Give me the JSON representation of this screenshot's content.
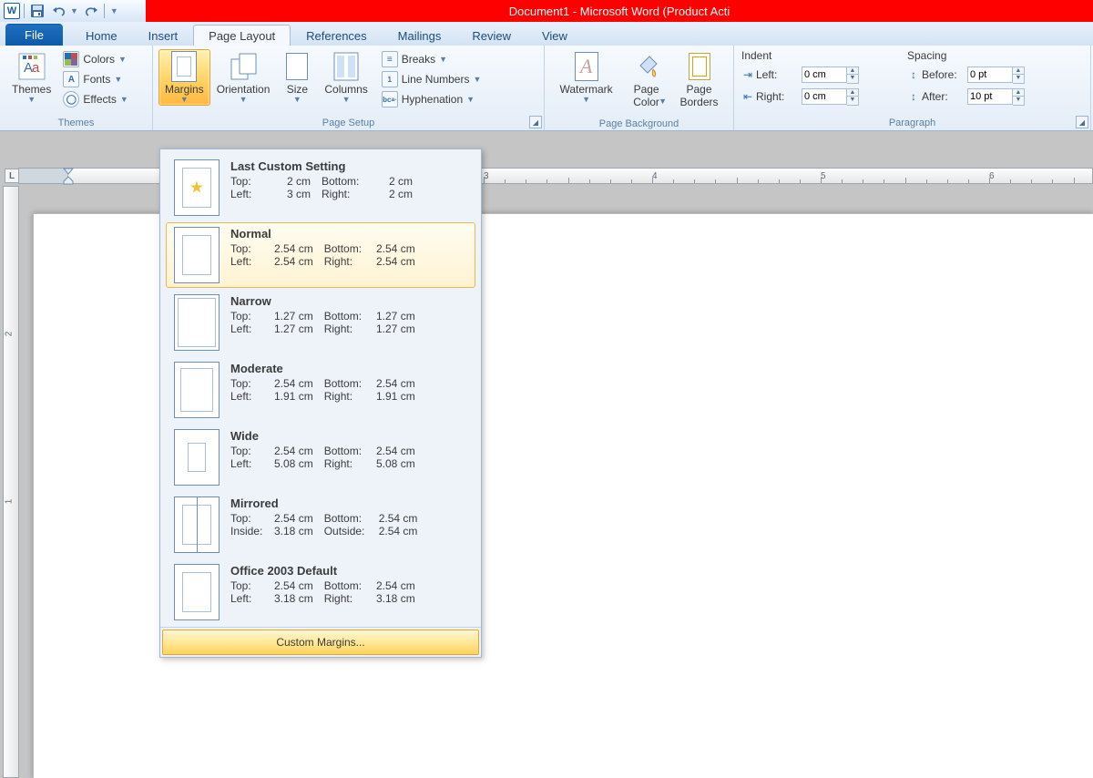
{
  "title": "Document1 - Microsoft Word (Product Acti",
  "tabs": {
    "file": "File",
    "home": "Home",
    "insert": "Insert",
    "pagelayout": "Page Layout",
    "references": "References",
    "mailings": "Mailings",
    "review": "Review",
    "view": "View"
  },
  "themes": {
    "group": "Themes",
    "themes": "Themes",
    "colors": "Colors",
    "fonts": "Fonts",
    "effects": "Effects"
  },
  "pagesetup": {
    "group": "Page Setup",
    "margins": "Margins",
    "orientation": "Orientation",
    "size": "Size",
    "columns": "Columns",
    "breaks": "Breaks",
    "lineNumbers": "Line Numbers",
    "hyphenation": "Hyphenation"
  },
  "pagebg": {
    "group": "Page Background",
    "watermark": "Watermark",
    "pageColor": "Page\nColor",
    "pageBorders": "Page\nBorders"
  },
  "paragraph": {
    "group": "Paragraph",
    "indent": "Indent",
    "spacing": "Spacing",
    "left": "Left:",
    "right": "Right:",
    "before": "Before:",
    "after": "After:",
    "leftVal": "0 cm",
    "rightVal": "0 cm",
    "beforeVal": "0 pt",
    "afterVal": "10 pt"
  },
  "margins_menu": {
    "custom": "Custom Margins...",
    "items": [
      {
        "title": "Last Custom Setting",
        "l1": "Top:",
        "v1": "2 cm",
        "l2": "Bottom:",
        "v2": "2 cm",
        "l3": "Left:",
        "v3": "3 cm",
        "l4": "Right:",
        "v4": "2 cm",
        "star": true
      },
      {
        "title": "Normal",
        "l1": "Top:",
        "v1": "2.54 cm",
        "l2": "Bottom:",
        "v2": "2.54 cm",
        "l3": "Left:",
        "v3": "2.54 cm",
        "l4": "Right:",
        "v4": "2.54 cm",
        "sel": true
      },
      {
        "title": "Narrow",
        "l1": "Top:",
        "v1": "1.27 cm",
        "l2": "Bottom:",
        "v2": "1.27 cm",
        "l3": "Left:",
        "v3": "1.27 cm",
        "l4": "Right:",
        "v4": "1.27 cm"
      },
      {
        "title": "Moderate",
        "l1": "Top:",
        "v1": "2.54 cm",
        "l2": "Bottom:",
        "v2": "2.54 cm",
        "l3": "Left:",
        "v3": "1.91 cm",
        "l4": "Right:",
        "v4": "1.91 cm"
      },
      {
        "title": "Wide",
        "l1": "Top:",
        "v1": "2.54 cm",
        "l2": "Bottom:",
        "v2": "2.54 cm",
        "l3": "Left:",
        "v3": "5.08 cm",
        "l4": "Right:",
        "v4": "5.08 cm"
      },
      {
        "title": "Mirrored",
        "l1": "Top:",
        "v1": "2.54 cm",
        "l2": "Bottom:",
        "v2": "2.54 cm",
        "l3": "Inside:",
        "v3": "3.18 cm",
        "l4": "Outside:",
        "v4": "2.54 cm",
        "mirrored": true
      },
      {
        "title": "Office 2003 Default",
        "l1": "Top:",
        "v1": "2.54 cm",
        "l2": "Bottom:",
        "v2": "2.54 cm",
        "l3": "Left:",
        "v3": "3.18 cm",
        "l4": "Right:",
        "v4": "3.18 cm"
      }
    ]
  },
  "ruler": {
    "nums": [
      "3",
      "4",
      "5",
      "6"
    ]
  }
}
